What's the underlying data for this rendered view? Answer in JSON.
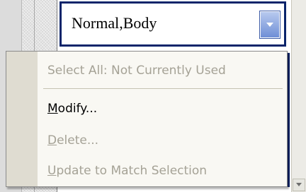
{
  "style_item": {
    "label": "Normal,Body"
  },
  "context_menu": {
    "items": [
      {
        "label": "Select All: Not Currently Used",
        "enabled": false
      },
      {
        "accel": "M",
        "rest": "odify...",
        "enabled": true
      },
      {
        "accel": "D",
        "rest": "elete...",
        "enabled": false
      },
      {
        "accel": "U",
        "rest": "pdate to Match Selection",
        "enabled": false
      }
    ]
  },
  "icons": {
    "dropdown": "chevron-down-icon",
    "scroll_down": "scroll-down-arrow-icon"
  },
  "colors": {
    "selection_border": "#0a246a",
    "dropdown_button": "#6f8fd6",
    "menu_background": "#f9f8f3",
    "menu_gutter": "#dfdcd1",
    "disabled_text": "#a5a296"
  }
}
